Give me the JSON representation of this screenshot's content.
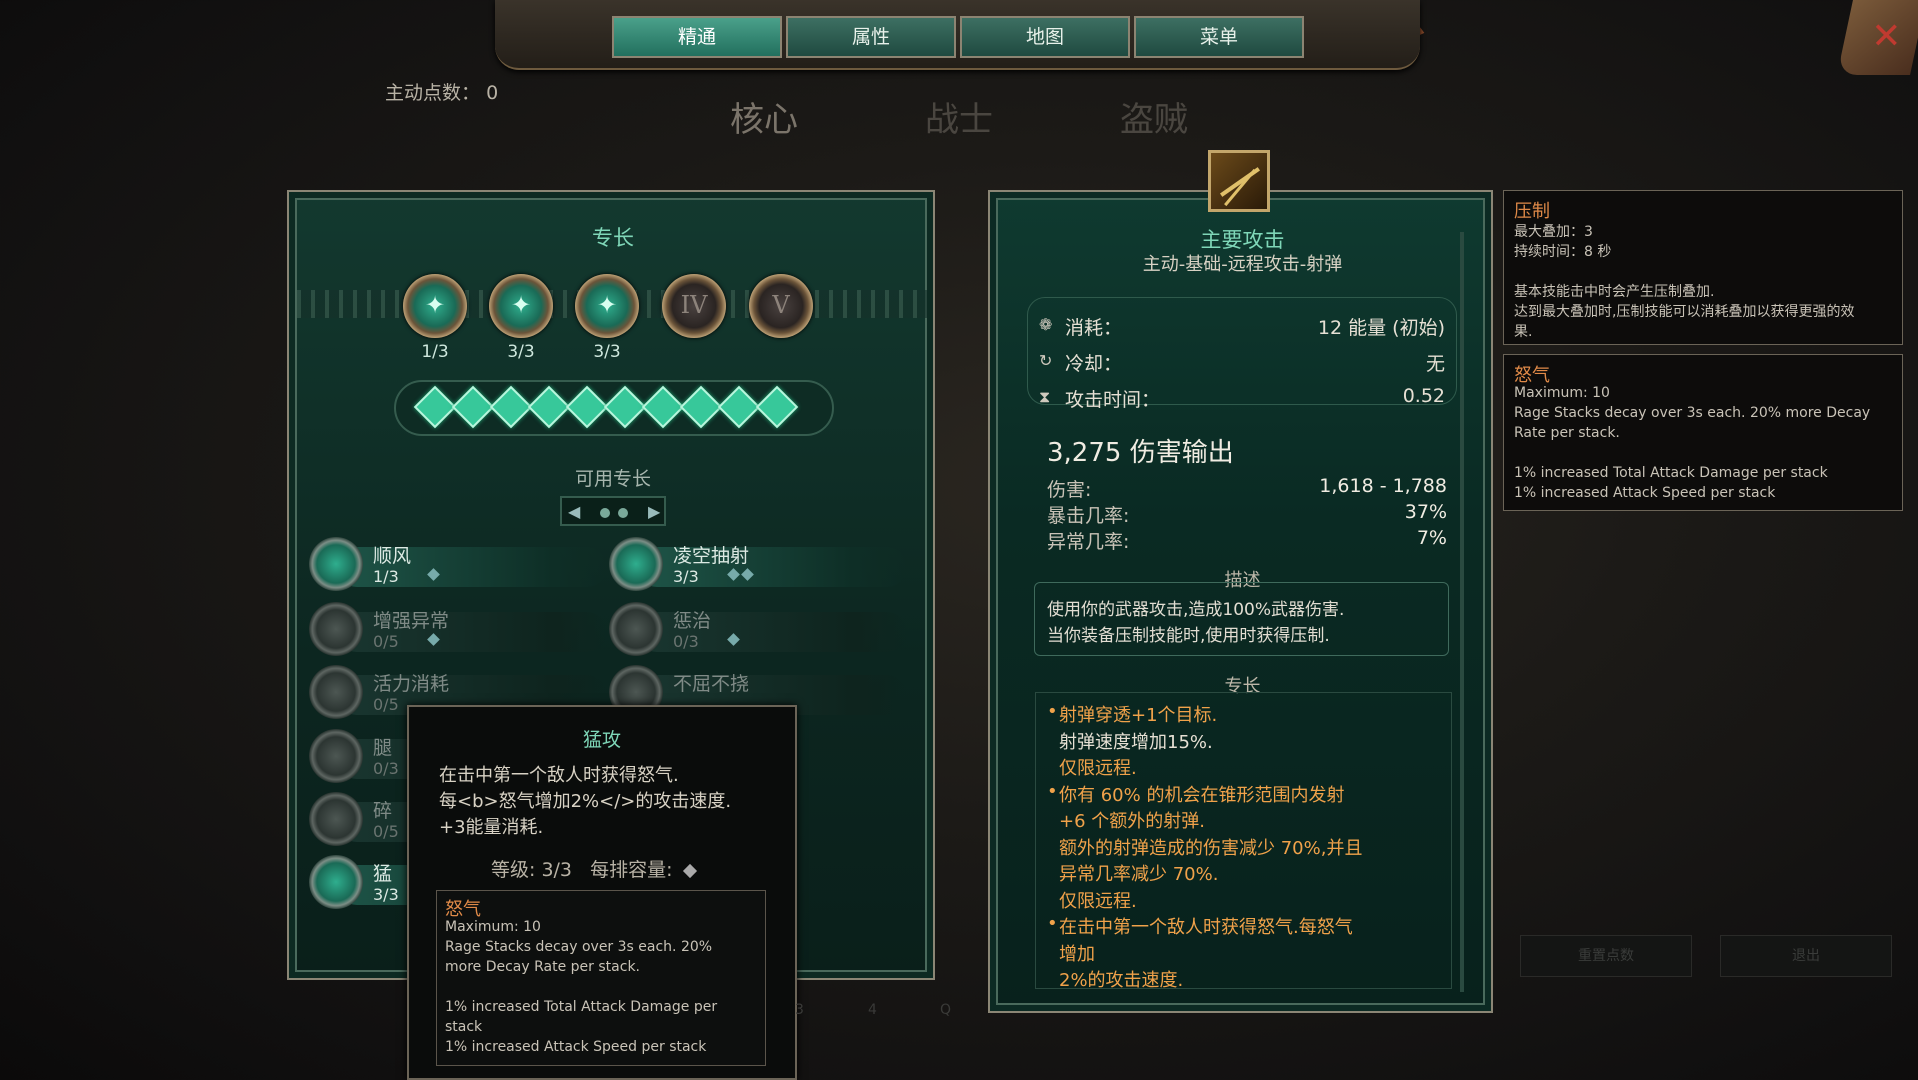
{
  "nav": {
    "tabs": [
      {
        "label": "精通"
      },
      {
        "label": "属性"
      },
      {
        "label": "地图"
      },
      {
        "label": "菜单"
      }
    ]
  },
  "points": {
    "label": "主动点数：",
    "value": "0"
  },
  "categories": [
    "核心",
    "战士",
    "盗贼"
  ],
  "left_panel": {
    "title": "专长",
    "medals": [
      {
        "count": "1/3"
      },
      {
        "count": "3/3"
      },
      {
        "count": "3/3"
      },
      {
        "numeral": "IV"
      },
      {
        "numeral": "V"
      }
    ],
    "gem_count": 10,
    "available_label": "可用专长",
    "skills": [
      {
        "name": "顺风",
        "count": "1/3",
        "dim": false,
        "pips": 1
      },
      {
        "name": "凌空抽射",
        "count": "3/3",
        "dim": false,
        "pips": 2
      },
      {
        "name": "增强异常",
        "count": "0/5",
        "dim": true,
        "pips": 1
      },
      {
        "name": "惩治",
        "count": "0/3",
        "dim": true,
        "pips": 1
      },
      {
        "name": "活力消耗",
        "count": "0/5",
        "dim": true,
        "pips": 0
      },
      {
        "name": "不屈不挠",
        "count": "",
        "dim": true,
        "pips": 0
      },
      {
        "name": "腿",
        "count": "0/3",
        "dim": true,
        "pips": 0
      },
      {
        "name": "碎",
        "count": "0/5",
        "dim": true,
        "pips": 0
      },
      {
        "name": "猛",
        "count": "3/3",
        "dim": false,
        "pips": 0
      }
    ]
  },
  "tooltip": {
    "title": "猛攻",
    "lines": [
      "在击中第一个敌人时获得怒气.",
      "每<b>怒气增加2%</>的攻击速度.",
      "+3能量消耗."
    ],
    "level": "等级: 3/3",
    "capacity": "每排容量:",
    "sub": {
      "title": "怒气",
      "lines": [
        "Maximum: 10",
        "Rage Stacks decay over 3s each. 20%",
        "more Decay Rate per stack.",
        "",
        "1% increased Total Attack Damage per",
        "stack",
        "1% increased Attack Speed per stack"
      ]
    }
  },
  "right_panel": {
    "title": "主要攻击",
    "subtitle": "主动-基础-远程攻击-射弹",
    "stats": [
      {
        "icon": "flame-icon",
        "label": "消耗：",
        "value": "12 能量 (初始)"
      },
      {
        "icon": "cooldown-icon",
        "label": "冷却：",
        "value": "无"
      },
      {
        "icon": "hourglass-icon",
        "label": "攻击时间：",
        "value": "0.52"
      }
    ],
    "damage_total": "3,275 伤害输出",
    "damage_lines": [
      {
        "label": "伤害:",
        "value": "1,618 - 1,788"
      },
      {
        "label": "暴击几率:",
        "value": "37%"
      },
      {
        "label": "异常几率:",
        "value": "7%"
      }
    ],
    "desc_header": "描述",
    "desc_lines": [
      "使用你的武器攻击,造成100%武器伤害.",
      "当你装备压制技能时,使用时获得压制."
    ],
    "spec_header": "专长",
    "spec_lines": [
      {
        "text": "射弹穿透+1个目标.",
        "bullet": true,
        "white": false
      },
      {
        "text": "射弹速度增加15%.",
        "bullet": false,
        "white": true
      },
      {
        "text": "仅限远程.",
        "bullet": false,
        "white": false
      },
      {
        "text": "你有 60% 的机会在锥形范围内发射",
        "bullet": true,
        "white": false
      },
      {
        "text": "+6 个额外的射弹.",
        "bullet": false,
        "white": false
      },
      {
        "text": "额外的射弹造成的伤害减少 70%,并且",
        "bullet": false,
        "white": false
      },
      {
        "text": "异常几率减少 70%.",
        "bullet": false,
        "white": false
      },
      {
        "text": "仅限远程.",
        "bullet": false,
        "white": false
      },
      {
        "text": "在击中第一个敌人时获得怒气.每怒气",
        "bullet": true,
        "white": false
      },
      {
        "text": "增加",
        "bullet": false,
        "white": false
      },
      {
        "text": "2%的攻击速度.",
        "bullet": false,
        "white": false
      }
    ]
  },
  "side_boxes": [
    {
      "title": "压制",
      "lines": [
        "最大叠加：3",
        "持续时间：8 秒",
        "",
        "基本技能击中时会产生压制叠加.",
        "达到最大叠加时,压制技能可以消耗叠加以获得更强的效",
        "果."
      ]
    },
    {
      "title": "怒气",
      "lines": [
        "Maximum: 10",
        "Rage Stacks decay over 3s each. 20% more Decay",
        "Rate per stack.",
        "",
        "1% increased Total Attack Damage per stack",
        "1% increased Attack Speed per stack"
      ]
    }
  ],
  "ghost_buttons": [
    "重置点数",
    "退出"
  ],
  "hotbar_keys": [
    "3",
    "4",
    "Q"
  ]
}
